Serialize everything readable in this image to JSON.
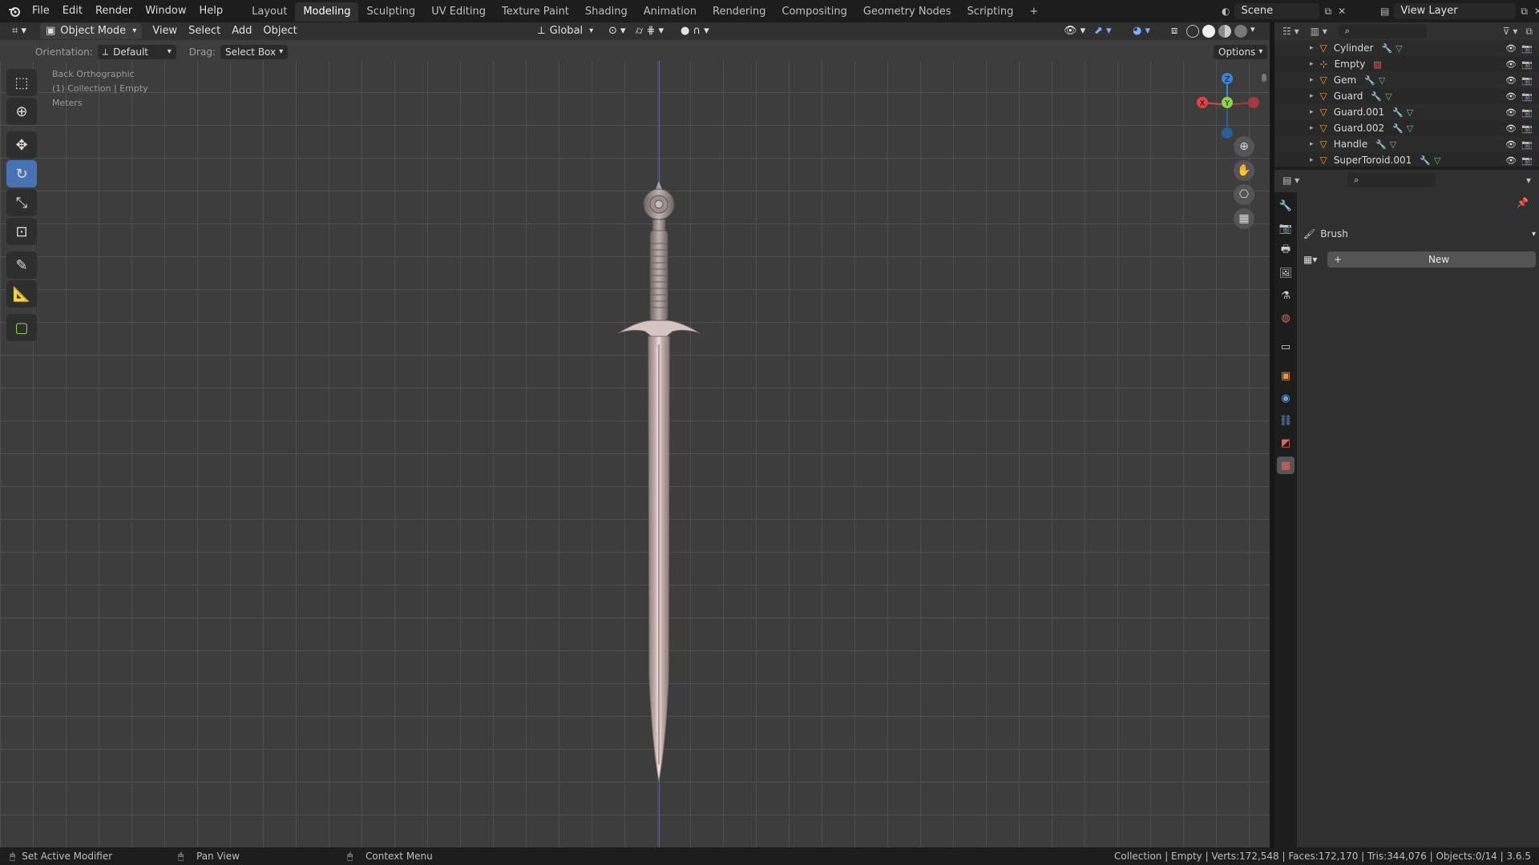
{
  "topbar": {
    "menus": [
      "File",
      "Edit",
      "Render",
      "Window",
      "Help"
    ],
    "workspaces": [
      "Layout",
      "Modeling",
      "Sculpting",
      "UV Editing",
      "Texture Paint",
      "Shading",
      "Animation",
      "Rendering",
      "Compositing",
      "Geometry Nodes",
      "Scripting"
    ],
    "active_workspace": "Modeling",
    "add_tab": "+",
    "scene": "Scene",
    "view_layer": "View Layer"
  },
  "viewport_header": {
    "mode": "Object Mode",
    "menus": [
      "View",
      "Select",
      "Add",
      "Object"
    ],
    "transform": "Global"
  },
  "tool_header": {
    "orientation_label": "Orientation:",
    "orientation_value": "Default",
    "drag_label": "Drag:",
    "drag_value": "Select Box",
    "options": "Options"
  },
  "viewport": {
    "view_name": "Back Orthographic",
    "context": "(1) Collection | Empty",
    "units": "Meters",
    "gizmo": {
      "z": "Z",
      "y": "Y",
      "x": "X"
    }
  },
  "outliner": {
    "items": [
      {
        "name": "Cylinder"
      },
      {
        "name": "Empty"
      },
      {
        "name": "Gem"
      },
      {
        "name": "Guard"
      },
      {
        "name": "Guard.001"
      },
      {
        "name": "Guard.002"
      },
      {
        "name": "Handle"
      },
      {
        "name": "SuperToroid.001"
      }
    ]
  },
  "properties": {
    "brush_label": "Brush",
    "new_button": "New"
  },
  "statusbar": {
    "left_action": "Set Active Modifier",
    "middle_action": "Pan View",
    "right_action": "Context Menu",
    "stats": "Collection | Empty | Verts:172,548 | Faces:172,170 | Tris:344,076 | Objects:0/14 | 3.6.5"
  },
  "colors": {
    "accent": "#4772b3",
    "axis_x": "#e2414b",
    "axis_y": "#8bd54a",
    "axis_z": "#3a86d4"
  }
}
